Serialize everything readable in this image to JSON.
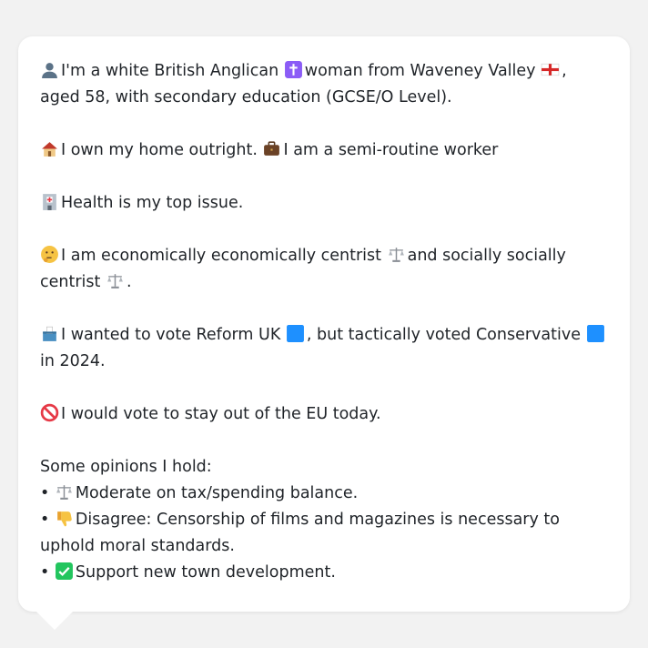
{
  "profile": {
    "intro_text": "I'm a white British Anglican",
    "intro_woman": "woman from Waveney Valley",
    "intro_age": ", aged 58, with secondary education (GCSE/O Level).",
    "home_text": "I own my home outright.",
    "work_text": "I am a semi-routine worker",
    "health_text": "Health is my top issue.",
    "econ_text": "I am economically economically centrist",
    "social_text": "and socially socially centrist",
    "social_end": ".",
    "vote_text": "I wanted to vote Reform UK",
    "vote_text2": ", but tactically voted Conservative",
    "vote_text3": "in 2024.",
    "eu_text": "I would vote to stay out of the EU today.",
    "opinions_heading": "Some opinions I hold:",
    "opinions": [
      {
        "bullet": "•",
        "text": "Moderate on tax/spending balance."
      },
      {
        "bullet": "•",
        "text": "Disagree: Censorship of films and magazines is necessary to uphold moral standards."
      },
      {
        "bullet": "•",
        "text": "Support new town development."
      }
    ]
  },
  "icons": {
    "person": "person-icon",
    "cross": "latin-cross-icon",
    "flag": "england-flag-icon",
    "house": "house-icon",
    "briefcase": "briefcase-icon",
    "hospital": "hospital-icon",
    "thinking": "thinking-face-icon",
    "scales": "scales-icon",
    "ballot": "ballot-box-icon",
    "square": "blue-square-icon",
    "no": "prohibited-icon",
    "thumbs_down": "thumbs-down-icon",
    "check": "check-mark-icon"
  },
  "colors": {
    "card": "#ffffff",
    "background": "#f2f2f2",
    "text": "#1f2328",
    "blue_square": "#1e90ff",
    "cross_purple": "#8b5cf6",
    "check_green": "#22c55e"
  }
}
